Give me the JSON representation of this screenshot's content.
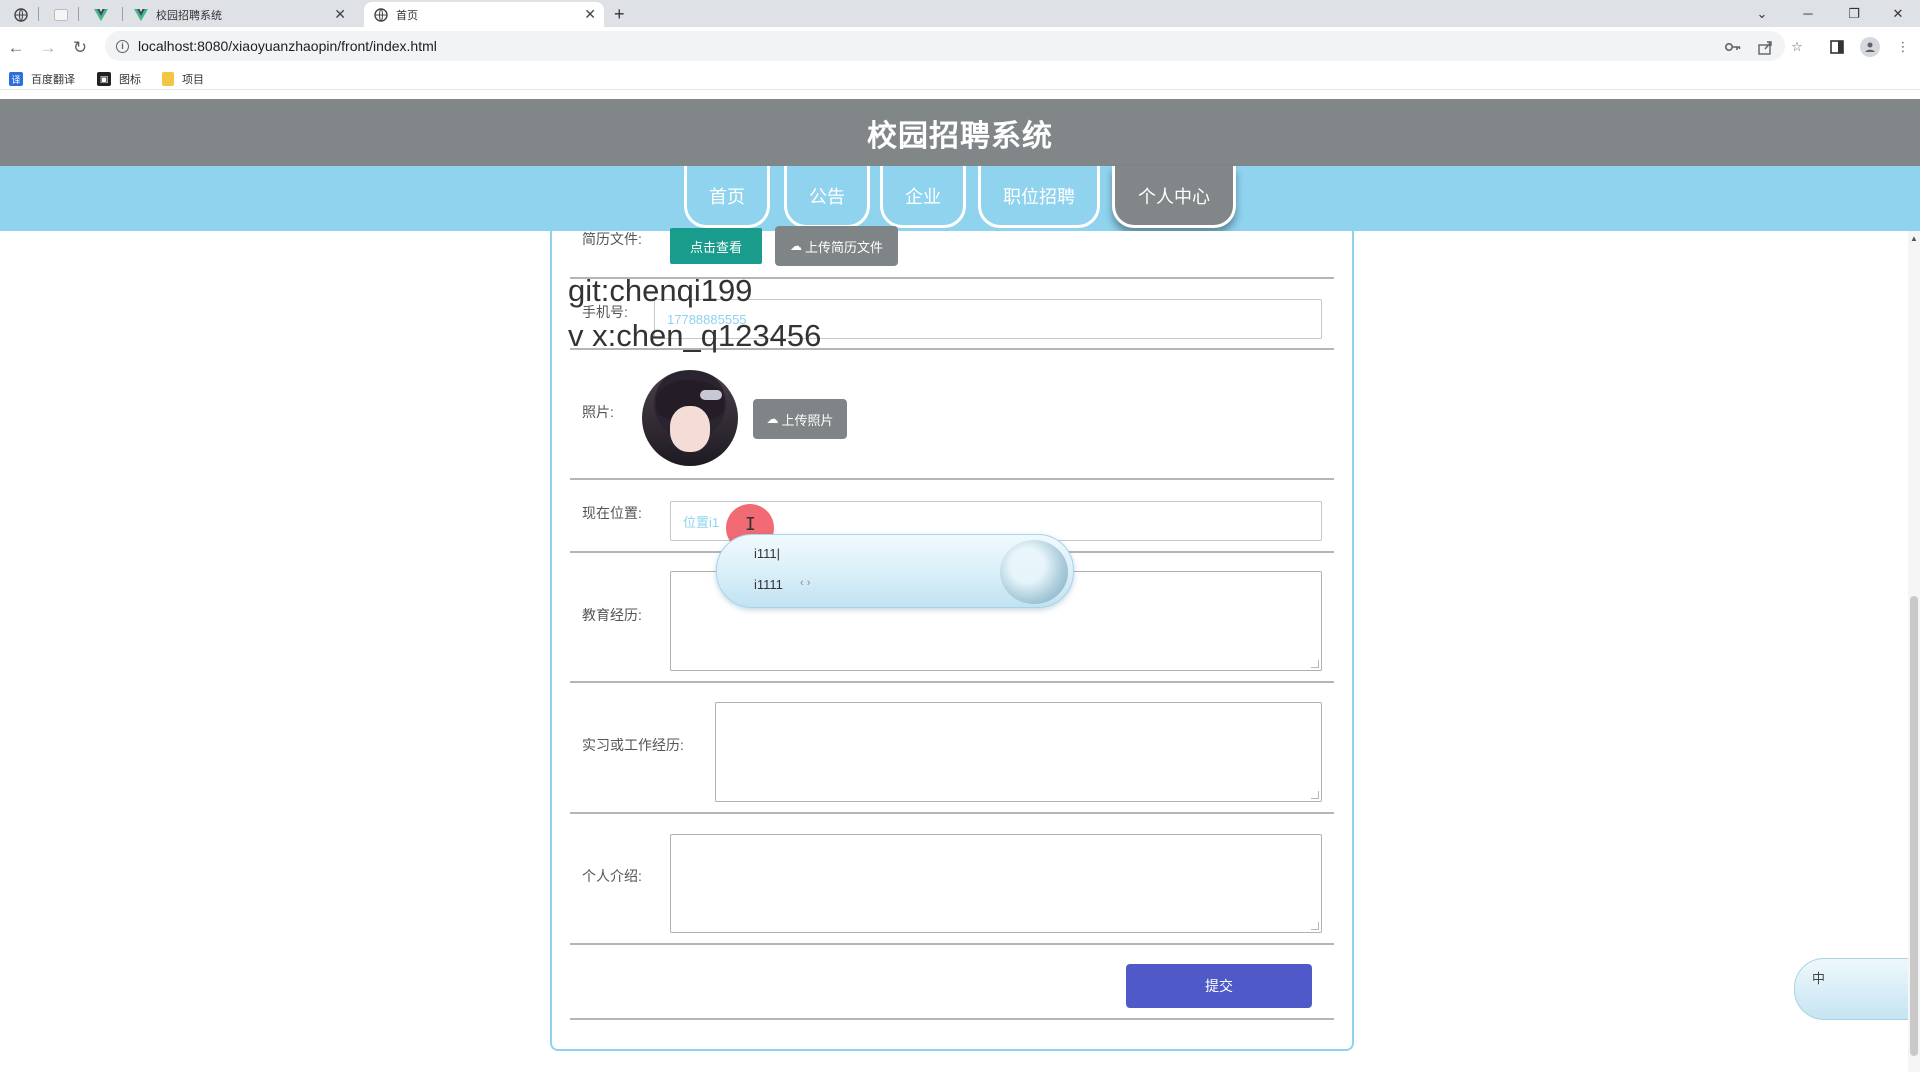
{
  "browser": {
    "tabs": [
      {
        "label": "",
        "icon": "globe-icon"
      },
      {
        "label": "",
        "icon": "blank-page-icon"
      },
      {
        "label": "",
        "icon": "vue-icon"
      },
      {
        "label": "校园招聘系统",
        "icon": "vue-icon"
      },
      {
        "label": "首页",
        "icon": "globe-icon"
      }
    ],
    "new_tab": "+",
    "url": "localhost:8080/xiaoyuanzhaopin/front/index.html",
    "bookmarks": [
      {
        "label": "百度翻译",
        "icon": "translate-icon",
        "color": "#2a6fdb"
      },
      {
        "label": "图标",
        "icon": "image-icon",
        "color": "#222222"
      },
      {
        "label": "项目",
        "icon": "folder-icon",
        "color": "#f4c542"
      }
    ]
  },
  "site": {
    "title": "校园招聘系统",
    "nav": [
      "首页",
      "公告",
      "企业",
      "职位招聘",
      "个人中心"
    ],
    "active_nav": "个人中心"
  },
  "form": {
    "resume_label": "简历文件:",
    "view_button": "点击查看",
    "upload_resume_button": "上传简历文件",
    "phone_label": "手机号:",
    "phone_value": "17788885555",
    "photo_label": "照片:",
    "upload_photo_button": "上传照片",
    "location_label": "现在位置:",
    "location_value": "位置i1",
    "education_label": "教育经历:",
    "experience_label": "实习或工作经历:",
    "intro_label": "个人介绍:",
    "submit_button": "提交"
  },
  "overlay": {
    "watermark_line1": "git:chenqi199",
    "watermark_line2": "v x:chen_q123456",
    "ime_composition": "i111|",
    "ime_candidate": "i1111",
    "ime_arrows": "‹ ›",
    "ime_mode": "中"
  },
  "colors": {
    "header_bg": "#818789",
    "nav_bg": "#8fd3ef",
    "teal_button": "#1a9c8d",
    "grey_button": "#7f8487",
    "submit_button": "#4f59c8"
  }
}
